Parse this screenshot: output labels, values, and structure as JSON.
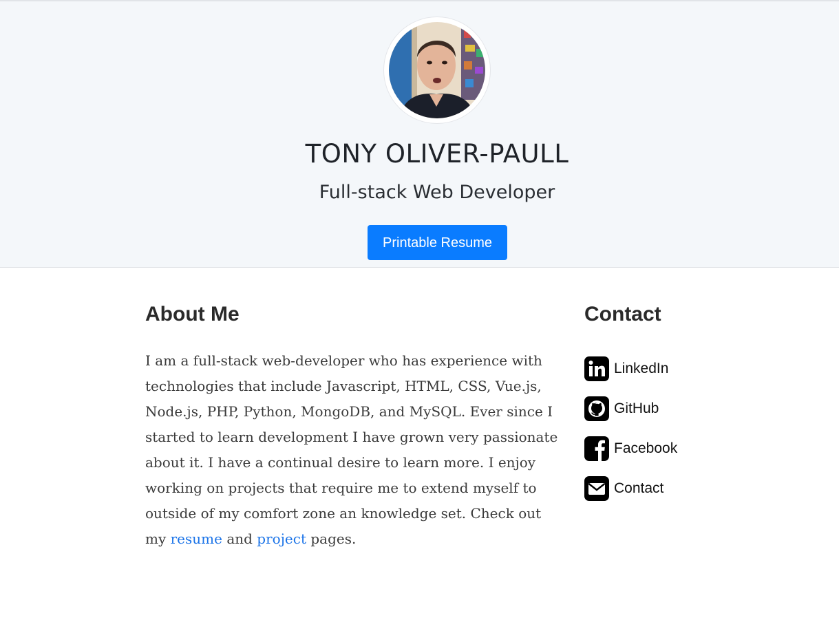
{
  "header": {
    "name": "TONY OLIVER-PAULL",
    "subtitle": "Full-stack Web Developer",
    "resume_button": "Printable Resume"
  },
  "about": {
    "heading": "About Me",
    "text_intro": "I am a full-stack web-developer who has experience with technologies that include Javascript, HTML, CSS, Vue.js, Node.js, PHP, Python, MongoDB, and MySQL. Ever since I started to learn development I have grown very passionate about it. I have a continual desire to learn more. I enjoy working on projects that require me to extend myself to outside of my comfort zone an knowledge set. Check out my",
    "link_resume": "resume",
    "text_and": "and",
    "link_project": "project",
    "text_end": "pages."
  },
  "contact": {
    "heading": "Contact",
    "items": [
      {
        "label": "LinkedIn",
        "icon": "linkedin-icon"
      },
      {
        "label": "GitHub",
        "icon": "github-icon"
      },
      {
        "label": "Facebook",
        "icon": "facebook-icon"
      },
      {
        "label": "Contact",
        "icon": "envelope-icon"
      }
    ]
  },
  "colors": {
    "hero_background": "#f4f7fa",
    "button": "#0a7cff",
    "link": "#1a73e8"
  }
}
